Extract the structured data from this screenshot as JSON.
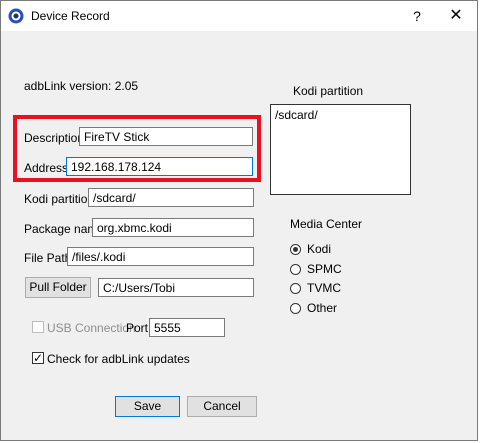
{
  "window": {
    "title": "Device Record",
    "help_label": "?",
    "close_label": "✕"
  },
  "version_label": "adbLink version: 2.05",
  "kodi_partition_box": {
    "label": "Kodi partition",
    "value": "/sdcard/"
  },
  "form": {
    "description": {
      "label": "Description",
      "value": "FireTV Stick"
    },
    "address": {
      "label": "Address",
      "value": "192.168.178.124"
    },
    "kodi_partition": {
      "label": "Kodi partition",
      "value": "/sdcard/"
    },
    "package_name": {
      "label": "Package name",
      "value": "org.xbmc.kodi"
    },
    "file_path": {
      "label": "File Path",
      "value": "/files/.kodi"
    },
    "pull_folder": {
      "button_label": "Pull Folder",
      "value": "C:/Users/Tobi"
    },
    "usb_connection": {
      "label": "USB Connection",
      "checked": false,
      "enabled": false
    },
    "port": {
      "label": "Port",
      "value": "5555"
    },
    "check_updates": {
      "label": "Check for adbLink updates",
      "checked": true
    }
  },
  "media_center": {
    "label": "Media Center",
    "options": [
      "Kodi",
      "SPMC",
      "TVMC",
      "Other"
    ],
    "selected": "Kodi"
  },
  "buttons": {
    "save": "Save",
    "cancel": "Cancel"
  },
  "colors": {
    "highlight": "#e81123",
    "focus": "#0078d7"
  },
  "icons": {
    "app": "app-logo-icon"
  }
}
